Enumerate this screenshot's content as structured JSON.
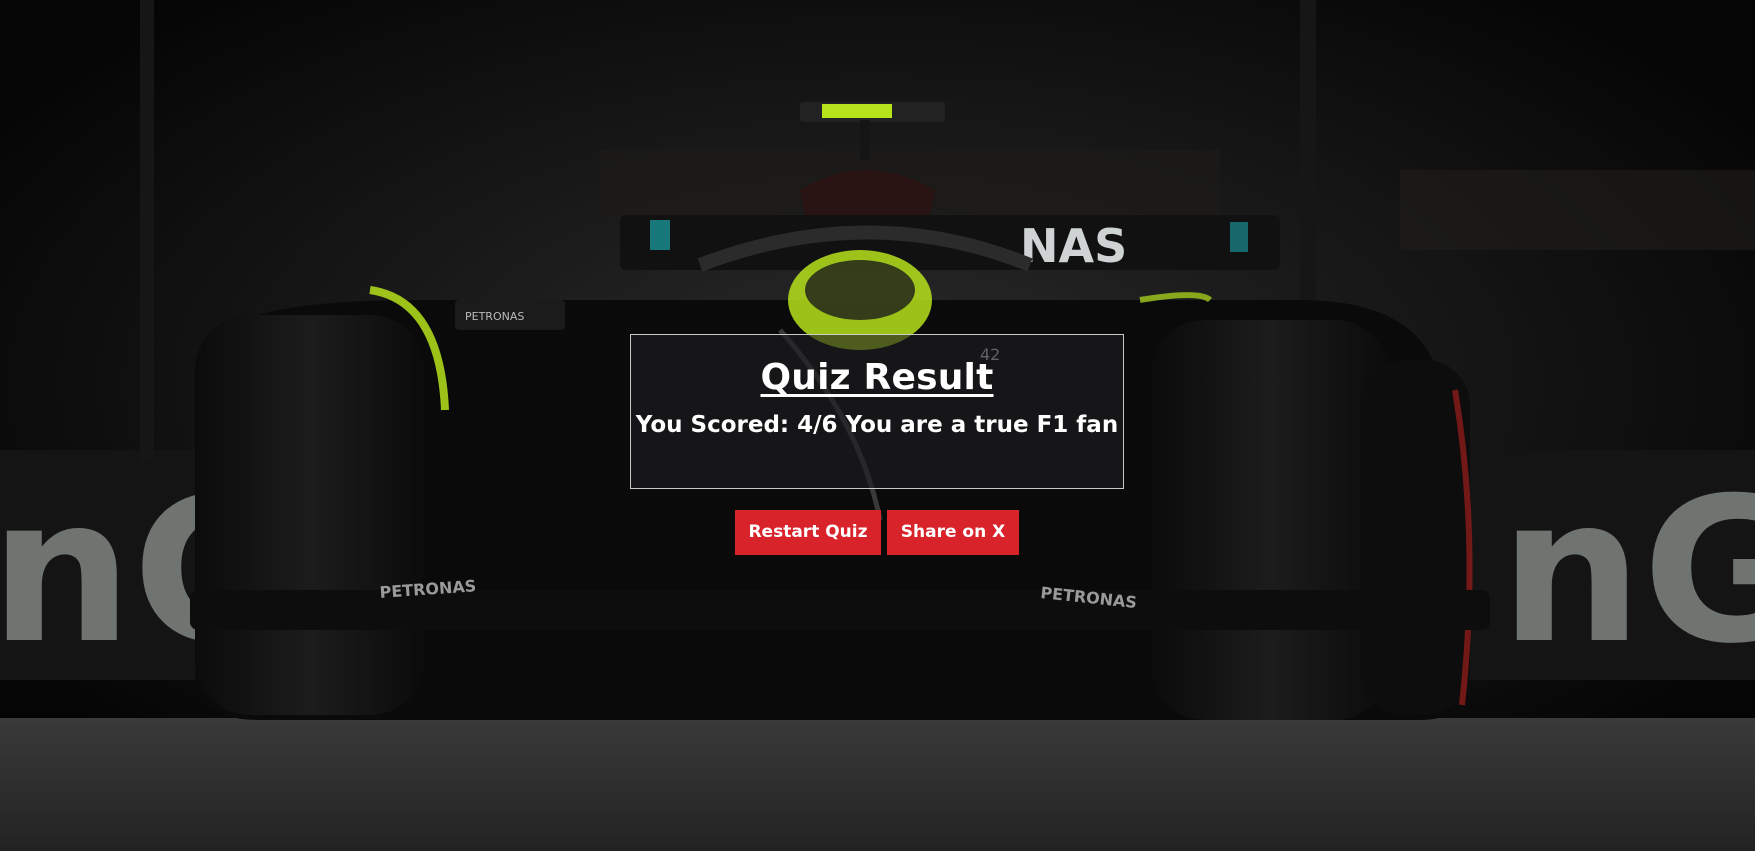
{
  "result": {
    "title": "Quiz Result",
    "score_text": "You Scored: 4/6 You are a true F1 fan"
  },
  "buttons": {
    "restart_label": "Restart Quiz",
    "share_label": "Share on X"
  },
  "background": {
    "sponsor_text_left": "nG",
    "sponsor_text_right": "nG",
    "car_text_petronas": "PETRONAS",
    "car_text_nas": "NAS",
    "car_number": "42"
  },
  "colors": {
    "button": "#d9232a",
    "accent_green": "#b6e31c",
    "panel_border": "#dcdcdc"
  }
}
